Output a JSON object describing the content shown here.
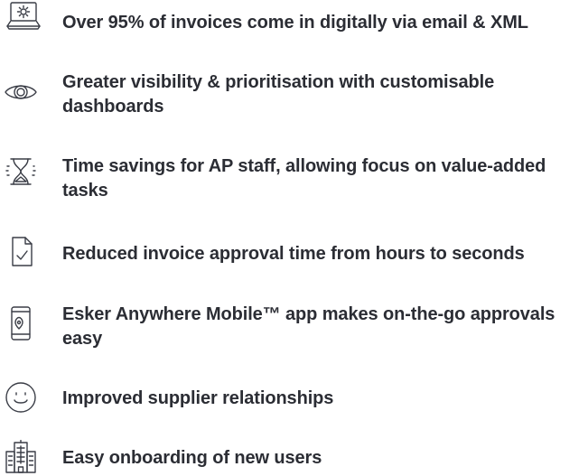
{
  "benefits": [
    {
      "icon": "laptop-gear-icon",
      "text": "Over 95% of invoices come in digitally via email & XML"
    },
    {
      "icon": "eye-icon",
      "text": "Greater visibility & prioritisation with customisable dashboards"
    },
    {
      "icon": "hourglass-icon",
      "text": "Time savings for AP staff, allowing focus on value-added tasks"
    },
    {
      "icon": "document-check-icon",
      "text": "Reduced invoice approval time from hours to seconds"
    },
    {
      "icon": "mobile-location-icon",
      "text": "Esker Anywhere Mobile™ app makes on-the-go approvals easy"
    },
    {
      "icon": "smiley-icon",
      "text": "Improved supplier relationships"
    },
    {
      "icon": "buildings-icon",
      "text": "Easy onboarding of new users"
    }
  ],
  "colors": {
    "text": "#2b2d34",
    "icon_stroke": "#3a3d46",
    "background": "#ffffff"
  }
}
